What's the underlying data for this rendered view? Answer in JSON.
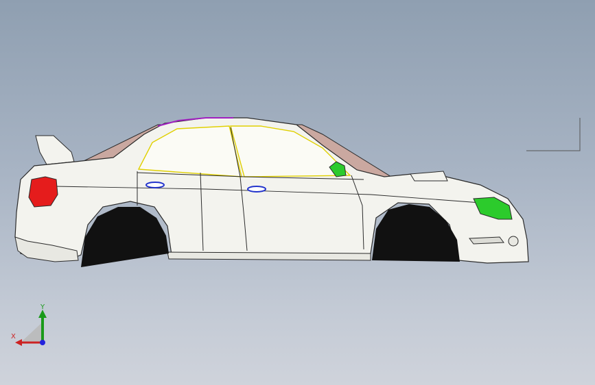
{
  "viewport": {
    "background_top": "#8f9fb1",
    "background_bottom": "#cfd3db"
  },
  "model": {
    "name": "car-body-side-view",
    "body_color": "#f3f3ee",
    "edge_color": "#2a2a2a",
    "glass_color": "#fbfbf5",
    "glass_outline": "#e0d000",
    "roof_highlight": "#a020c0",
    "taillight_color": "#e51c1c",
    "headlight_color": "#2ccb2c",
    "mirror_color": "#2ccb2c",
    "handle_color": "#2233cc",
    "shadow_panel_color": "#caa8a0",
    "wheel_well_color": "#111111"
  },
  "triad": {
    "y_label": "Y",
    "x_label": "X",
    "y_color": "#1a9a1a",
    "x_color": "#cc2222",
    "z_color": "#2222dd"
  }
}
